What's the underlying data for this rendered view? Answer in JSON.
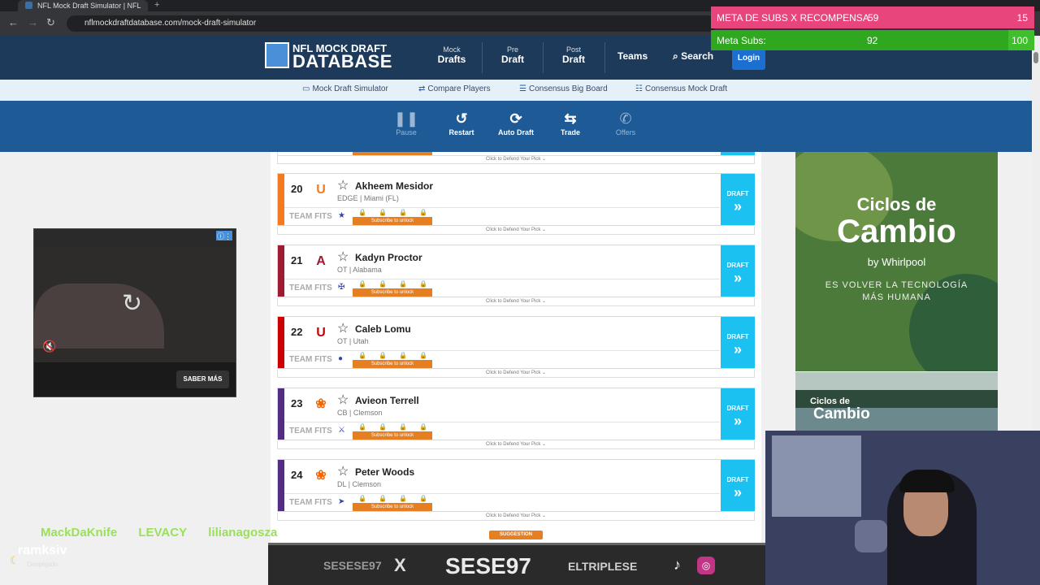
{
  "browser": {
    "tab_title": "NFL Mock Draft Simulator | NFL",
    "url_site": "nflmockdraftdatabase.com",
    "url_path": "/mock-draft-simulator"
  },
  "header": {
    "logo_line1": "NFL MOCK DRAFT",
    "logo_line2": "DATABASE",
    "nav": [
      {
        "small": "Mock",
        "big": "Drafts"
      },
      {
        "small": "Pre",
        "big": "Draft"
      },
      {
        "small": "Post",
        "big": "Draft"
      }
    ],
    "teams": "Teams",
    "search": "Search",
    "login": "Login"
  },
  "subnav": [
    {
      "icon": "monitor-icon",
      "glyph": "▭",
      "label": "Mock Draft Simulator"
    },
    {
      "icon": "compare-icon",
      "glyph": "⇄",
      "label": "Compare Players"
    },
    {
      "icon": "list-icon",
      "glyph": "☰",
      "label": "Consensus Big Board"
    },
    {
      "icon": "users-icon",
      "glyph": "☷",
      "label": "Consensus Mock Draft"
    }
  ],
  "toolbar": {
    "pause": "Pause",
    "restart": "Restart",
    "auto_draft": "Auto Draft",
    "trade": "Trade",
    "offers": "Offers"
  },
  "picks": [
    {
      "num": "20",
      "name": "Akheem Mesidor",
      "pos": "EDGE | Miami (FL)",
      "bar": "#f47a20",
      "logo": "U",
      "logo_color": "#f47a20",
      "team_glyph": "★"
    },
    {
      "num": "21",
      "name": "Kadyn Proctor",
      "pos": "OT | Alabama",
      "bar": "#9e1b32",
      "logo": "A",
      "logo_color": "#9e1b32",
      "team_glyph": "✠"
    },
    {
      "num": "22",
      "name": "Caleb Lomu",
      "pos": "OT | Utah",
      "bar": "#cc0000",
      "logo": "U",
      "logo_color": "#cc0000",
      "team_glyph": "●"
    },
    {
      "num": "23",
      "name": "Avieon Terrell",
      "pos": "CB | Clemson",
      "bar": "#522d80",
      "logo": "❀",
      "logo_color": "#f56600",
      "team_glyph": "⚔"
    },
    {
      "num": "24",
      "name": "Peter Woods",
      "pos": "DL | Clemson",
      "bar": "#522d80",
      "logo": "❀",
      "logo_color": "#f56600",
      "team_glyph": "➤"
    }
  ],
  "card_labels": {
    "team_fits": "TEAM FITS",
    "subscribe": "Subscribe to unlock",
    "draft": "DRAFT",
    "defend": "Click to Defend Your Pick ⌄"
  },
  "suggestion": "SUGGESTION",
  "video_ad": {
    "cta": "SABER MÁS"
  },
  "right_ad": {
    "line1": "Ciclos de",
    "line2": "Cambio",
    "brand": "by Whirlpool",
    "tag1": "ES VOLVER LA TECNOLOGÍA",
    "tag2": "MÁS HUMANA",
    "small1": "Ciclos de",
    "small2": "Cambio"
  },
  "stream": {
    "goal1_label": "META DE SUBS X RECOMPENSA",
    "goal1_value": "59",
    "goal1_target": "15",
    "goal2_label": "Meta Subs:",
    "goal2_value": "92",
    "goal2_target": "100",
    "goal2_progress": 0.92,
    "chat_names": [
      "MackDaKnife",
      "LEVACY",
      "lilianagosza"
    ],
    "weather_user": "ramksiv",
    "weather_text": "Despejado",
    "banner_handle1": "SESESE97",
    "banner_x": "X",
    "banner_big": "SESE97",
    "banner_handle2": "ELTRIPLESE"
  }
}
